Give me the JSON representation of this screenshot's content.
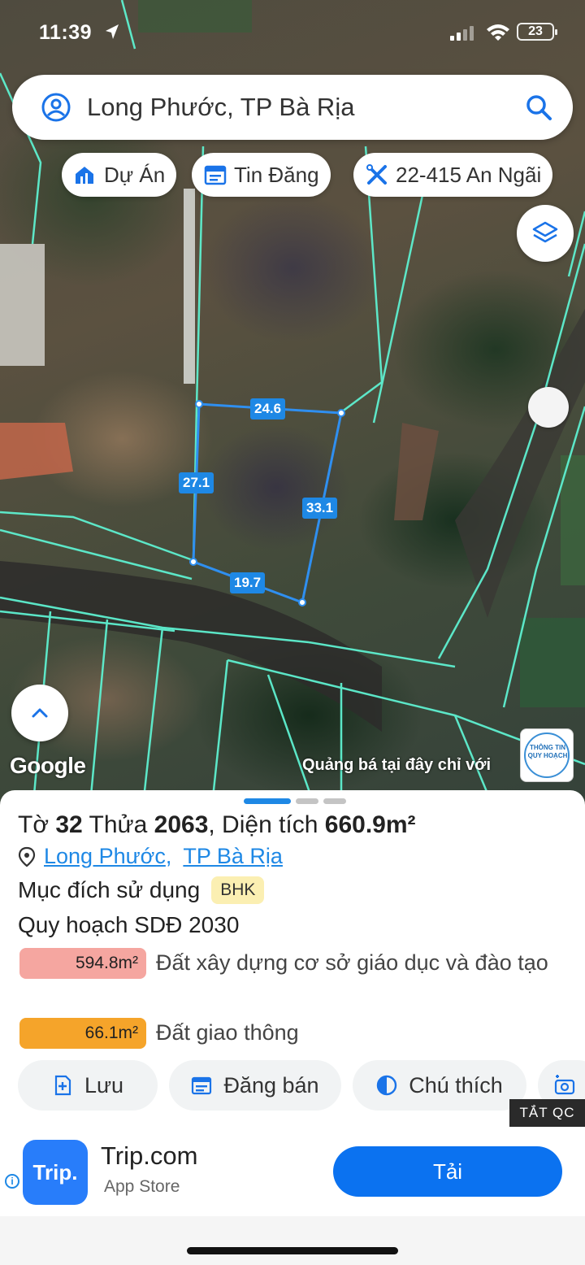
{
  "status": {
    "time": "11:39",
    "battery": "23"
  },
  "search": {
    "query": "Long Phước, TP Bà Rịa"
  },
  "chips": [
    {
      "label": "Dự Án",
      "icon": "house-chart-icon"
    },
    {
      "label": "Tin Đăng",
      "icon": "calendar-icon"
    },
    {
      "label": "22-415 An Ngãi",
      "icon": "crossed-tools-icon"
    }
  ],
  "map": {
    "edges": [
      "24.6",
      "27.1",
      "33.1",
      "19.7"
    ],
    "google": "Google",
    "ad_banner": "Quảng bá tại đây chỉ với",
    "logo_text": "THÔNG TIN QUY HOẠCH",
    "parcel_color": "#2f8ff0",
    "boundary_color": "#5ef0d0"
  },
  "parcel": {
    "prefix_sheet": "Tờ",
    "sheet": "32",
    "prefix_plot": "Thửa",
    "plot": "2063",
    "area_label": ", Diện tích",
    "area": "660.9m²",
    "ward": "Long Phước",
    "city": "TP Bà Rịa",
    "purpose_label": "Mục đích sử dụng",
    "purpose_code": "BHK",
    "plan_label": "Quy hoạch SDĐ 2030",
    "zones": [
      {
        "area": "594.8m²",
        "desc": "Đất xây dựng cơ sở giáo dục và đào tạo",
        "color": "#f5a6a0"
      },
      {
        "area": "66.1m²",
        "desc": "Đất giao thông",
        "color": "#f5a42a"
      }
    ]
  },
  "actions": [
    {
      "label": "Lưu",
      "icon": "add-file-icon"
    },
    {
      "label": "Đăng bán",
      "icon": "calendar-icon"
    },
    {
      "label": "Chú thích",
      "icon": "half-circle-icon"
    }
  ],
  "ad": {
    "close_label": "TẮT QC",
    "app_logo": "Trip.",
    "app_name": "Trip.com",
    "store": "App Store",
    "install_label": "Tải"
  }
}
